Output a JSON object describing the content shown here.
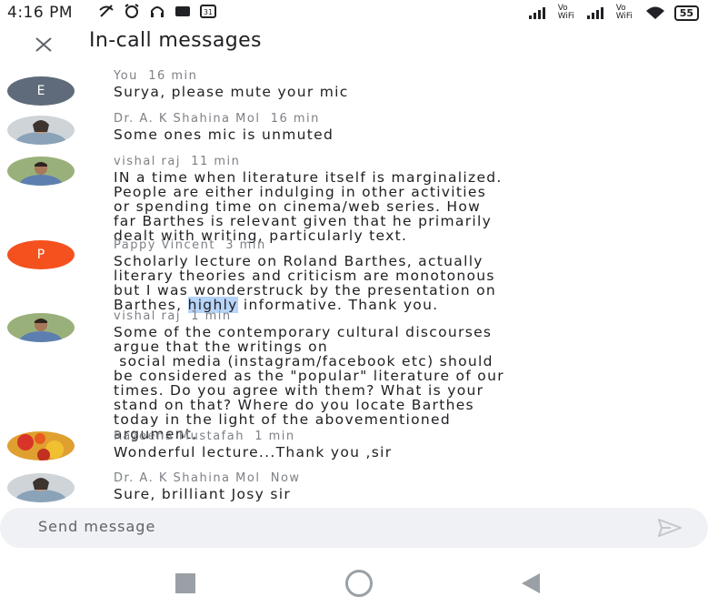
{
  "status_bar": {
    "time": "4:16 PM",
    "network_1": "Vo WiFi",
    "network_2": "Vo WiFi",
    "battery": "55"
  },
  "header": {
    "title": "In-call messages"
  },
  "messages": [
    {
      "sender": "You",
      "time": "16 min",
      "avatar_letter": "E",
      "avatar_color": "#5f6b7a",
      "text": "Surya, please mute your mic"
    },
    {
      "sender": "Dr. A. K Shahina Mol",
      "time": "16 min",
      "avatar_icon": "profile-photo-icon",
      "text": "Some ones mic is unmuted"
    },
    {
      "sender": "vishal raj",
      "time": "11 min",
      "avatar_icon": "profile-photo-icon",
      "text": "IN a time when literature itself is marginalized.\nPeople are either indulging in other activities\nor spending time on cinema/web series. How\nfar Barthes is relevant given that he primarily\ndealt with writing, particularly text."
    },
    {
      "sender": "Pappy Vincent",
      "time": "3 min",
      "avatar_letter": "P",
      "avatar_color": "#f4511e",
      "text_line1": "Scholarly lecture on Roland Barthes, actually",
      "text_line2": "literary theories and criticism are monotonous",
      "text_line3": "but I was wonderstruck by the presentation on",
      "text_line4_pre": "Barthes, ",
      "text_line4_hl": "highly",
      "text_line4_post": " informative. Thank you."
    },
    {
      "sender": "vishal raj",
      "time": "1 min",
      "avatar_icon": "profile-photo-icon",
      "text": "Some of the contemporary cultural discourses\nargue that the writings on\n social media (instagram/facebook etc) should\nbe considered as the \"popular\" literature of our\ntimes. Do you agree with them? What is your\nstand on that? Where do you locate Barthes\ntoday in the light of the abovementioned\nargument."
    },
    {
      "sender": "Razeena Mustafah",
      "time": "1 min",
      "avatar_icon": "profile-photo-icon",
      "text": "Wonderful lecture...Thank you ,sir"
    },
    {
      "sender": "Dr. A. K Shahina Mol",
      "time": "Now",
      "avatar_icon": "profile-photo-icon",
      "text": "Sure, brilliant Josy sir"
    }
  ],
  "composer": {
    "placeholder": "Send message"
  },
  "colors": {
    "highlight": "#b7d4f9",
    "meta_text": "#7d8085"
  }
}
